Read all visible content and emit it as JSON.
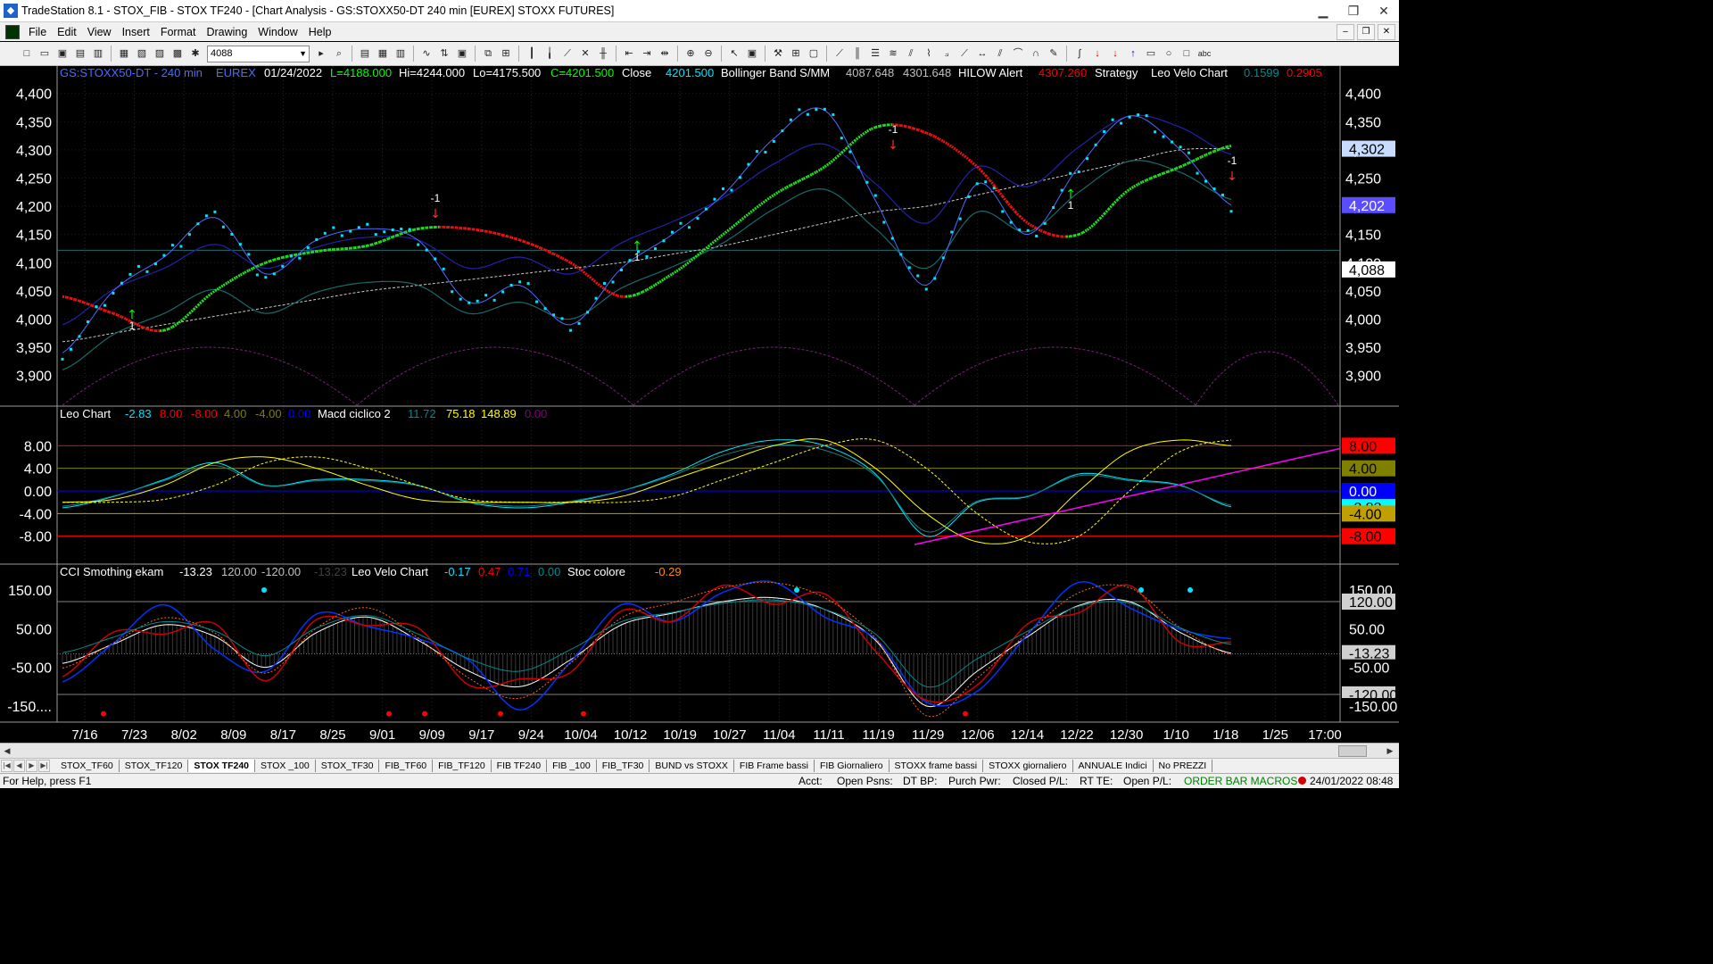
{
  "window": {
    "title": "TradeStation 8.1 - STOX_FIB - STOX TF240 - [Chart Analysis - GS:STOXX50-DT  240 min  [EUREX] STOXX FUTURES]",
    "buttons": [
      "minimize",
      "maximize",
      "close"
    ]
  },
  "menu": {
    "items": [
      "File",
      "Edit",
      "View",
      "Insert",
      "Format",
      "Drawing",
      "Window",
      "Help"
    ]
  },
  "toolbar": {
    "symbol_value": "4088"
  },
  "header": {
    "symbol": "GS:STOXX50-DT - 240 min",
    "exchange": "EUREX",
    "date": "01/24/2022",
    "low_close": "L=4188.000",
    "hi": "Hi=4244.000",
    "lo": "Lo=4175.500",
    "c": "C=4201.500",
    "close_label": "Close",
    "close_val": "4201.500",
    "bb_label": "Bollinger Band S/MM",
    "bb_v1": "4087.648",
    "bb_v2": "4301.648",
    "hilow_label": "HILOW Alert",
    "hilow_val": "4307.260",
    "strategy": "Strategy",
    "leo_velo": "Leo Velo Chart",
    "lv_v1": "0.1599",
    "lv_v2": "0.2905"
  },
  "panel2": {
    "leo_chart": "Leo Chart",
    "v1": "-2.83",
    "v2": "8.00",
    "v3": "-8.00",
    "v4": "4.00",
    "v5": "-4.00",
    "v6": "0.00",
    "macd_label": "Macd ciclico 2",
    "m1": "11.72",
    "m2": "75.18",
    "m3": "148.89",
    "m4": "0.00"
  },
  "panel3": {
    "cci_label": "CCI Smothing ekam",
    "c1": "-13.23",
    "c2": "120.00",
    "c3": "-120.00",
    "c4": "-13.23",
    "leo_velo": "Leo Velo Chart",
    "l1": "-0.17",
    "l2": "0.47",
    "l3": "0.71",
    "l4": "0.00",
    "stoc_label": "Stoc colore",
    "s1": "-0.29"
  },
  "axes": {
    "price_ticks": [
      "4,400",
      "4,350",
      "4,300",
      "4,250",
      "4,200",
      "4,150",
      "4,100",
      "4,050",
      "4,000",
      "3,950",
      "3,900"
    ],
    "price_badges": [
      {
        "label": "4,302",
        "value": 4302,
        "bg": "#c8dcff",
        "fg": "#000000"
      },
      {
        "label": "4,202",
        "value": 4202,
        "bg": "#5a4cff",
        "fg": "#ffffff"
      },
      {
        "label": "4,088",
        "value": 4088,
        "bg": "#ffffff",
        "fg": "#000000"
      }
    ],
    "osc_ticks": [
      "8.00",
      "4.00",
      "0.00",
      "-4.00",
      "-8.00"
    ],
    "osc_badges": [
      {
        "label": "8.00",
        "value": 8,
        "bg": "#ff0000",
        "fg": "#000000"
      },
      {
        "label": "4.00",
        "value": 4,
        "bg": "#808000",
        "fg": "#000000"
      },
      {
        "label": "0.00",
        "value": 0,
        "bg": "#0000ff",
        "fg": "#ffffff"
      },
      {
        "label": "-2.83",
        "value": -2.83,
        "bg": "#00ffff",
        "fg": "#000000"
      },
      {
        "label": "-4.00",
        "value": -4,
        "bg": "#c0a000",
        "fg": "#000000"
      },
      {
        "label": "-8.00",
        "value": -8,
        "bg": "#ff0000",
        "fg": "#000000"
      }
    ],
    "cci_ticks": [
      "150.00",
      "50.00",
      "-50.00",
      "-150...."
    ],
    "cci_badges": [
      {
        "label": "150.00",
        "value": 150,
        "bg": "#000000",
        "fg": "#ffffff"
      },
      {
        "label": "120.00",
        "value": 120,
        "bg": "#d0d0d0",
        "fg": "#000000"
      },
      {
        "label": "50.00",
        "value": 50,
        "bg": "#000000",
        "fg": "#ffffff"
      },
      {
        "label": "-13.23",
        "value": -13.23,
        "bg": "#d0d0d0",
        "fg": "#000000"
      },
      {
        "label": "-50.00",
        "value": -50,
        "bg": "#000000",
        "fg": "#ffffff"
      },
      {
        "label": "-120.00",
        "value": -120,
        "bg": "#d0d0d0",
        "fg": "#000000"
      },
      {
        "label": "-150.00",
        "value": -150,
        "bg": "#000000",
        "fg": "#ffffff"
      }
    ],
    "date_ticks": [
      "7/16",
      "7/23",
      "8/02",
      "8/09",
      "8/17",
      "8/25",
      "9/01",
      "9/09",
      "9/17",
      "9/24",
      "10/04",
      "10/12",
      "10/19",
      "10/27",
      "11/04",
      "11/11",
      "11/19",
      "11/29",
      "12/06",
      "12/14",
      "12/22",
      "12/30",
      "1/10",
      "1/18",
      "1/25",
      "17:00"
    ]
  },
  "signals": [
    "1",
    "-1",
    "1",
    "-1",
    "1",
    "-1"
  ],
  "chart_data": [
    {
      "type": "line",
      "title": "GS:STOXX50-DT - 240 min",
      "x": [
        "7/16",
        "7/23",
        "8/02",
        "8/09",
        "8/17",
        "8/25",
        "9/01",
        "9/09",
        "9/17",
        "9/24",
        "10/04",
        "10/12",
        "10/19",
        "10/27",
        "11/04",
        "11/11",
        "11/19",
        "11/29",
        "12/06",
        "12/14",
        "12/22",
        "12/30",
        "1/10",
        "1/18"
      ],
      "ylim": [
        3860,
        4420
      ],
      "series": [
        {
          "name": "Close",
          "color": "#00e5ff",
          "values": [
            3940,
            4050,
            4110,
            4180,
            4080,
            4140,
            4160,
            4140,
            4030,
            4060,
            3990,
            4090,
            4150,
            4220,
            4320,
            4370,
            4210,
            4060,
            4240,
            4150,
            4270,
            4360,
            4300,
            4202
          ]
        },
        {
          "name": "Bollinger Band S/MM",
          "color": "#ffffff",
          "values": [
            3960,
            3975,
            3990,
            4005,
            4020,
            4035,
            4050,
            4060,
            4070,
            4080,
            4090,
            4100,
            4115,
            4130,
            4150,
            4170,
            4190,
            4200,
            4220,
            4240,
            4260,
            4280,
            4300,
            4302
          ]
        },
        {
          "name": "HILOW Alert",
          "color": "#ff0000",
          "values": [
            4040,
            4010,
            3980,
            4050,
            4100,
            4120,
            4130,
            4160,
            4160,
            4140,
            4100,
            4040,
            4080,
            4150,
            4220,
            4270,
            4340,
            4330,
            4270,
            4170,
            4150,
            4230,
            4270,
            4307
          ]
        }
      ]
    },
    {
      "type": "line",
      "title": "Leo Chart / Macd ciclico 2",
      "ylim": [
        -12,
        12
      ],
      "series": [
        {
          "name": "Leo Chart",
          "color": "#00e5ff",
          "values": [
            -3,
            -1,
            2,
            5,
            1,
            2,
            2,
            1,
            -2,
            -3,
            -2,
            0,
            3,
            7,
            9,
            8,
            3,
            -8,
            -2,
            -1,
            3,
            2,
            1,
            -2.83
          ]
        },
        {
          "name": "Macd ciclico 2",
          "color": "#ffff00",
          "values": [
            -2,
            -1.5,
            1,
            5,
            6,
            4,
            1,
            -1.5,
            -2,
            -2,
            -2,
            -1,
            2,
            5,
            8,
            9,
            4,
            -4,
            -9,
            -8,
            0,
            7,
            9,
            8
          ]
        }
      ]
    },
    {
      "type": "line",
      "title": "CCI Smothing ekam",
      "ylim": [
        -180,
        180
      ],
      "series": [
        {
          "name": "CCI Smothing ekam",
          "color": "#ffffff",
          "values": [
            -40,
            10,
            60,
            30,
            -50,
            40,
            80,
            20,
            -60,
            -100,
            -30,
            60,
            90,
            120,
            130,
            100,
            20,
            -150,
            -60,
            30,
            110,
            120,
            40,
            -13.23
          ]
        }
      ]
    }
  ],
  "tabs": [
    "STOX_TF60",
    "STOX_TF120",
    "STOX TF240",
    "STOX _100",
    "STOX_TF30",
    "FIB_TF60",
    "FIB_TF120",
    "FIB TF240",
    "FIB _100",
    "FIB_TF30",
    "BUND vs STOXX",
    "FIB Frame bassi",
    "FIB Giornaliero",
    "STOXX frame bassi",
    "STOXX giornaliero",
    "ANNUALE Indici",
    "No PREZZI"
  ],
  "status": {
    "help": "For Help, press F1",
    "acct": "Acct:",
    "open_psns": "Open Psns:",
    "dt_bp": "DT BP:",
    "purch_pwr": "Purch Pwr:",
    "closed_pl": "Closed P/L:",
    "rt_te": "RT TE:",
    "open_pl": "Open P/L:",
    "order_bar": "ORDER BAR  MACROS",
    "datetime": "24/01/2022 08:48"
  }
}
